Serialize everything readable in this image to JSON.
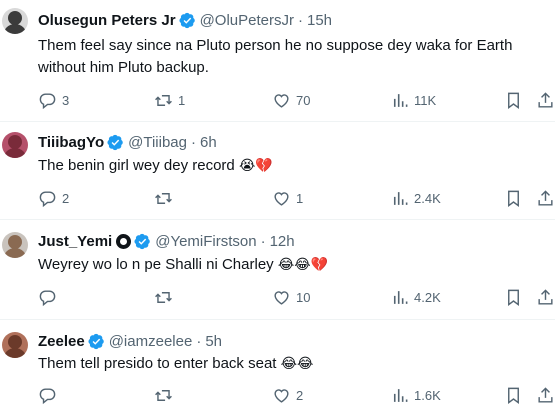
{
  "tweets": [
    {
      "name": "Olusegun Peters Jr",
      "handle": "@OluPetersJr",
      "time": "15h",
      "text": "Them feel say since na Pluto person he no suppose dey waka for Earth without him Pluto backup.",
      "replies": "3",
      "retweets": "1",
      "likes": "70",
      "views": "11K",
      "avatar_colors": [
        "#d9d9d9",
        "#3b3b3b"
      ]
    },
    {
      "name": "TiiibagYo",
      "handle": "@Tiiibag",
      "time": "6h",
      "text": "The benin girl wey dey record",
      "emojis": "😭💔",
      "replies": "2",
      "retweets": "",
      "likes": "1",
      "views": "2.4K",
      "avatar_colors": [
        "#b5506a",
        "#7a2b3a"
      ]
    },
    {
      "name": "Just_Yemi",
      "handle": "@YemiFirstson",
      "time": "12h",
      "text": "Weyrey wo lo n pe Shalli ni Charley",
      "emojis": "😂😂💔",
      "replies": "",
      "retweets": "",
      "likes": "10",
      "views": "4.2K",
      "avatar_colors": [
        "#8a6a52",
        "#c9c3bd"
      ]
    },
    {
      "name": "Zeelee",
      "handle": "@iamzeelee",
      "time": "5h",
      "text": "Them tell presido to enter back seat",
      "emojis": "😂😂",
      "replies": "",
      "retweets": "",
      "likes": "2",
      "views": "1.6K",
      "avatar_colors": [
        "#6b3a2a",
        "#b0705a"
      ]
    }
  ],
  "separator": "·",
  "colors": {
    "verified": "#1d9bf0",
    "muted": "#536471",
    "text": "#0f1419"
  }
}
